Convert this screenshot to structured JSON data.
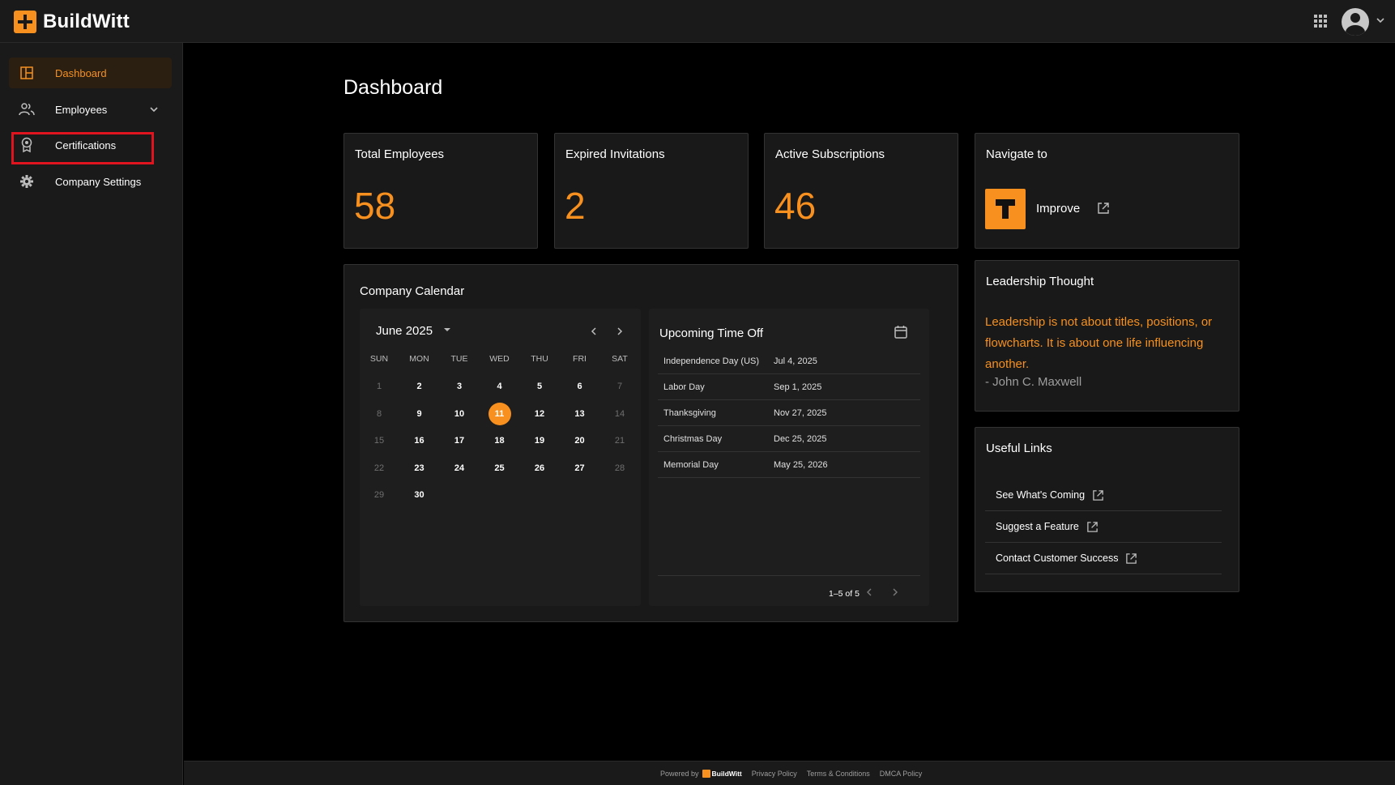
{
  "app": {
    "name": "BuildWitt"
  },
  "sidebar": {
    "items": [
      {
        "label": "Dashboard"
      },
      {
        "label": "Employees"
      },
      {
        "label": "Certifications"
      },
      {
        "label": "Company Settings"
      }
    ]
  },
  "page": {
    "title": "Dashboard"
  },
  "stats": [
    {
      "title": "Total Employees",
      "value": "58"
    },
    {
      "title": "Expired Invitations",
      "value": "2"
    },
    {
      "title": "Active Subscriptions",
      "value": "46"
    }
  ],
  "navigate": {
    "title": "Navigate to",
    "item_label": "Improve"
  },
  "calendar": {
    "title": "Company Calendar",
    "month_label": "June 2025",
    "weekdays": [
      "SUN",
      "MON",
      "TUE",
      "WED",
      "THU",
      "FRI",
      "SAT"
    ],
    "weeks": [
      [
        "1",
        "2",
        "3",
        "4",
        "5",
        "6",
        "7"
      ],
      [
        "8",
        "9",
        "10",
        "11",
        "12",
        "13",
        "14"
      ],
      [
        "15",
        "16",
        "17",
        "18",
        "19",
        "20",
        "21"
      ],
      [
        "22",
        "23",
        "24",
        "25",
        "26",
        "27",
        "28"
      ],
      [
        "29",
        "30",
        "",
        "",
        "",
        "",
        ""
      ]
    ],
    "today": "11"
  },
  "time_off": {
    "title": "Upcoming Time Off",
    "rows": [
      {
        "name": "Independence Day (US)",
        "date": "Jul 4, 2025"
      },
      {
        "name": "Labor Day",
        "date": "Sep 1, 2025"
      },
      {
        "name": "Thanksgiving",
        "date": "Nov 27, 2025"
      },
      {
        "name": "Christmas Day",
        "date": "Dec 25, 2025"
      },
      {
        "name": "Memorial Day",
        "date": "May 25, 2026"
      }
    ],
    "pagination": "1–5 of 5"
  },
  "leadership": {
    "title": "Leadership Thought",
    "quote": "Leadership is not about titles, positions, or flowcharts. It is about one life influencing another.",
    "author": "- John C. Maxwell"
  },
  "useful_links": {
    "title": "Useful Links",
    "items": [
      {
        "label": "See What's Coming"
      },
      {
        "label": "Suggest a Feature"
      },
      {
        "label": "Contact Customer Success"
      }
    ]
  },
  "footer": {
    "powered_by": "Powered by",
    "brand": "BuildWitt",
    "links": [
      "Privacy Policy",
      "Terms & Conditions",
      "DMCA Policy"
    ]
  },
  "colors": {
    "accent": "#f7901e",
    "background": "#000000",
    "surface": "#191919",
    "highlight": "#e0141e"
  }
}
